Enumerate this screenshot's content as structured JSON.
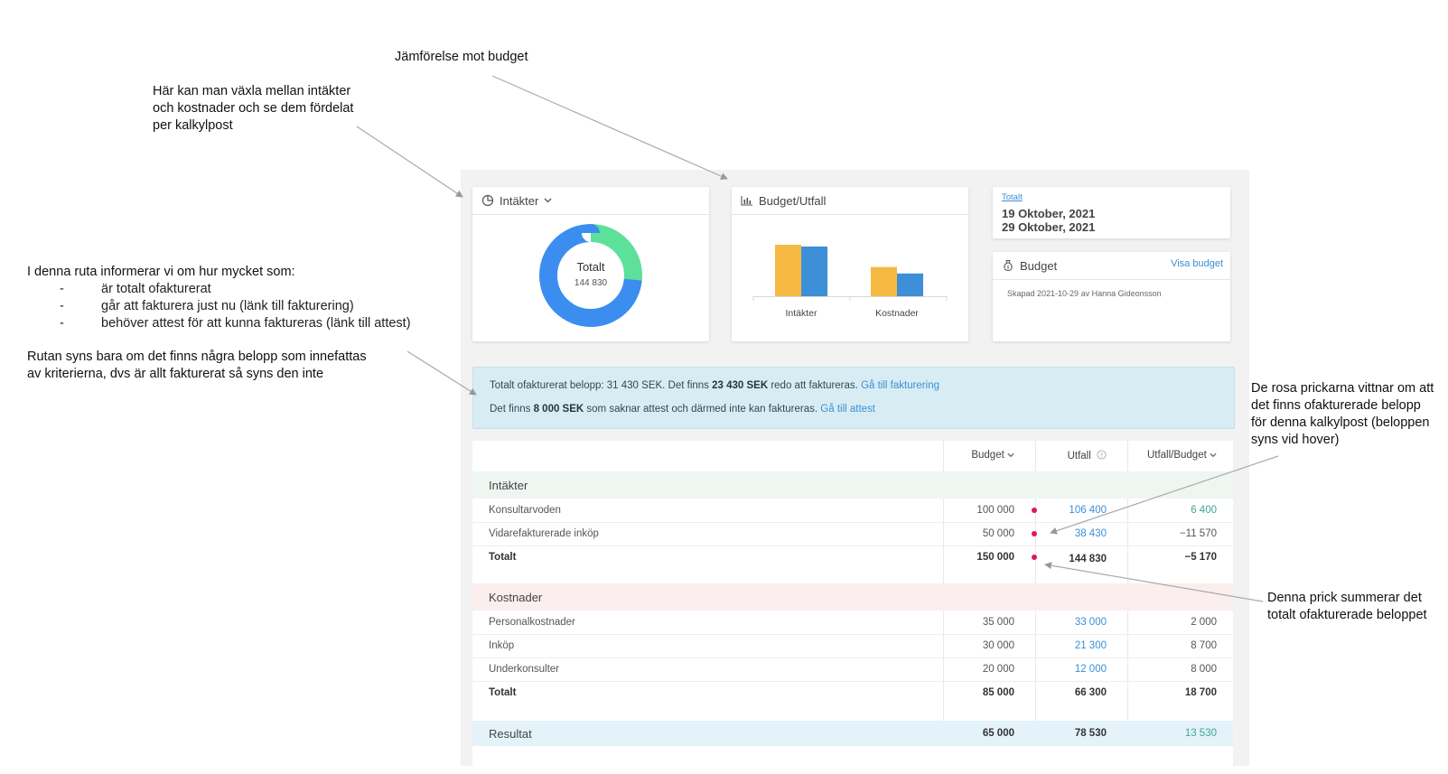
{
  "annotations": {
    "jamforelse": "Jämförelse mot budget",
    "vaxla": [
      "Här kan man växla mellan intäkter",
      "och kostnader och se dem fördelat",
      "per kalkylpost"
    ],
    "ruta_intro": "I denna ruta informerar vi om hur mycket som:",
    "ruta_bullets": [
      {
        "dash": "-",
        "text": "är totalt ofakturerat"
      },
      {
        "dash": "-",
        "text": "går att fakturera just nu (länk till fakturering)"
      },
      {
        "dash": "-",
        "text": "behöver attest för att kunna faktureras (länk till attest)"
      }
    ],
    "ruta_syns": [
      "Rutan syns bara om det finns några belopp som innefattas",
      "av kriterierna, dvs är allt fakturerat så syns den inte"
    ],
    "rosa": [
      "De rosa prickarna vittnar om att",
      "det finns ofakturerade belopp",
      "för denna kalkylpost (beloppen",
      "syns vid hover)"
    ],
    "prick": [
      "Denna prick summerar det",
      "totalt ofakturerade beloppet"
    ]
  },
  "donut_card": {
    "title": "Intäkter",
    "center_label": "Totalt",
    "center_value": "144 830",
    "icon": "pie-chart-icon",
    "slices": [
      {
        "value": 38430,
        "color": "#5de09a"
      },
      {
        "value": 106400,
        "color": "#3b8ef0"
      }
    ]
  },
  "budget_card": {
    "title": "Budget/Utfall",
    "icon": "bar-chart-icon"
  },
  "chart_data": {
    "type": "bar",
    "categories": [
      "Intäkter",
      "Kostnader"
    ],
    "series": [
      {
        "values": [
          150000,
          85000
        ],
        "color": "#f5b942"
      },
      {
        "values": [
          144830,
          66300
        ],
        "color": "#3d8fd8"
      }
    ]
  },
  "date_card": {
    "link": "Totalt",
    "from": "19 Oktober, 2021",
    "to": "29 Oktober, 2021"
  },
  "budget_info_card": {
    "title": "Budget",
    "link": "Visa budget",
    "created": "Skapad 2021-10-29 av Hanna Gideonsson",
    "icon": "money-bag-icon"
  },
  "info_box": {
    "line1_pre": "Totalt ofakturerat belopp: 31 430 SEK. Det finns ",
    "line1_bold": "23 430 SEK",
    "line1_post": " redo att faktureras.",
    "line1_link": "Gå till fakturering",
    "line2_pre": "Det finns ",
    "line2_bold": "8 000 SEK",
    "line2_post": " som saknar attest och därmed inte kan faktureras.",
    "line2_link": "Gå till attest"
  },
  "table": {
    "headers": {
      "budget": "Budget",
      "utfall": "Utfall",
      "utfall_budget": "Utfall/Budget"
    },
    "intakter_title": "Intäkter",
    "intakter_rows": [
      {
        "name": "Konsultarvoden",
        "budget": "100 000",
        "utfall": "106 400",
        "diff": "6 400"
      },
      {
        "name": "Vidarefakturerade inköp",
        "budget": "50 000",
        "utfall": "38 430",
        "diff": "−11 570"
      }
    ],
    "intakter_total": {
      "name": "Totalt",
      "budget": "150 000",
      "utfall": "144 830",
      "diff": "−5 170"
    },
    "kostnader_title": "Kostnader",
    "kostnader_rows": [
      {
        "name": "Personalkostnader",
        "budget": "35 000",
        "utfall": "33 000",
        "diff": "2 000"
      },
      {
        "name": "Inköp",
        "budget": "30 000",
        "utfall": "21 300",
        "diff": "8 700"
      },
      {
        "name": "Underkonsulter",
        "budget": "20 000",
        "utfall": "12 000",
        "diff": "8 000"
      }
    ],
    "kostnader_total": {
      "name": "Totalt",
      "budget": "85 000",
      "utfall": "66 300",
      "diff": "18 700"
    },
    "resultat": {
      "name": "Resultat",
      "budget": "65 000",
      "utfall": "78 530",
      "diff": "13 530"
    }
  },
  "colors": {
    "dot": "#d81b60",
    "link": "#3a8fd6",
    "green": "#3aa891"
  }
}
